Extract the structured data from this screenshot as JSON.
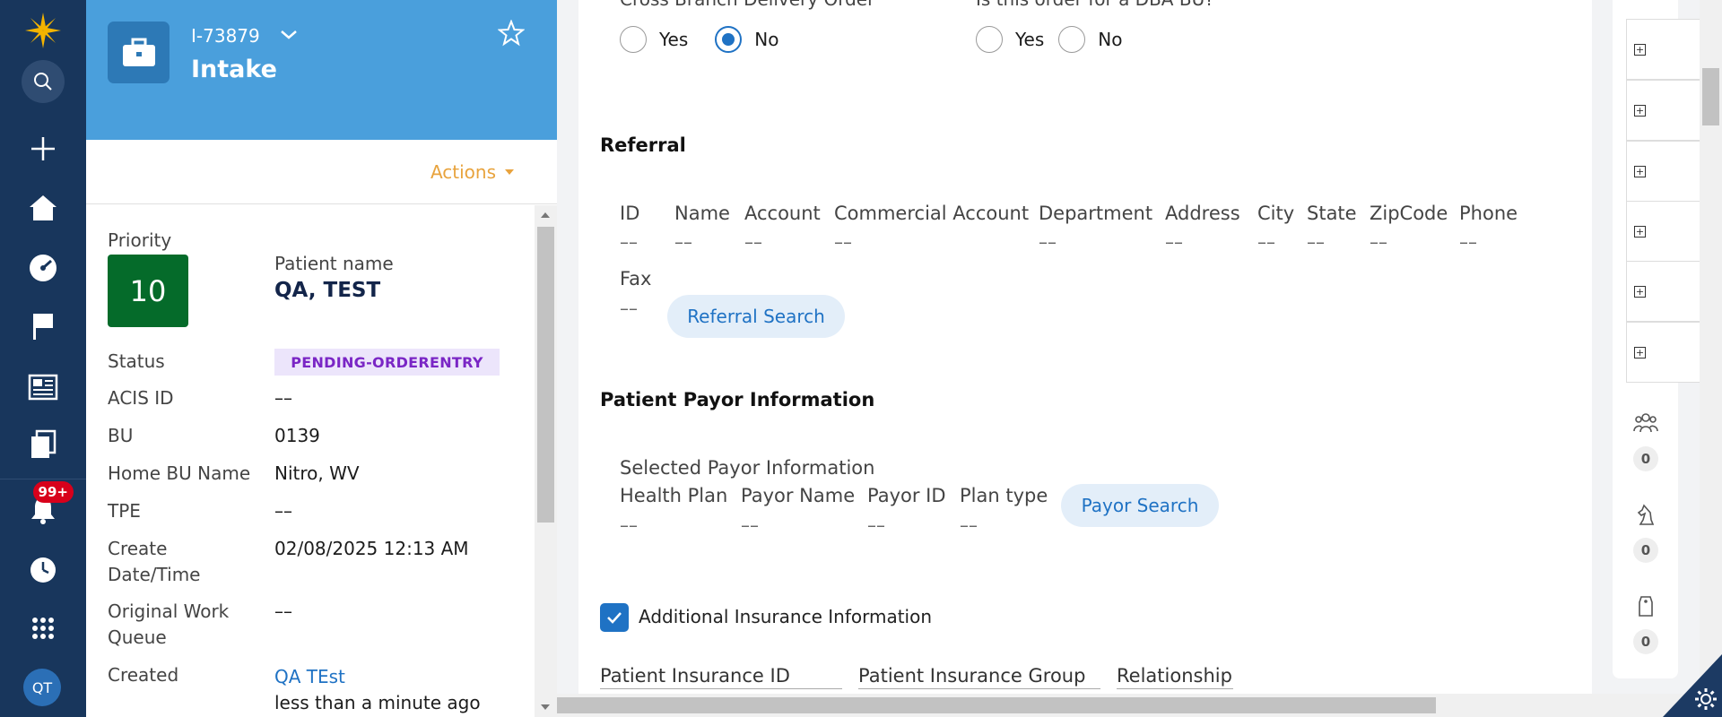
{
  "case": {
    "id": "I-73879",
    "title": "Intake",
    "actions_label": "Actions"
  },
  "details": {
    "priority_label": "Priority",
    "priority_value": "10",
    "patient_name_label": "Patient name",
    "patient_name": "QA, TEST",
    "status_label": "Status",
    "status_value": "PENDING-ORDERENTRY",
    "acis_label": "ACIS ID",
    "acis_value": "––",
    "bu_label": "BU",
    "bu_value": "0139",
    "home_bu_label": "Home BU Name",
    "home_bu_value": "Nitro, WV",
    "tpe_label": "TPE",
    "tpe_value": "––",
    "create_date_label_1": "Create",
    "create_date_label_2": "Date/Time",
    "create_date_value": "02/08/2025 12:13 AM",
    "owq_label_1": "Original Work",
    "owq_label_2": "Queue",
    "owq_value": "––",
    "created_label": "Created",
    "created_by": "QA TEst",
    "created_when": "less than a minute ago"
  },
  "form": {
    "cross_branch": {
      "label": "Cross Branch Delivery Order",
      "yes": "Yes",
      "no": "No",
      "selected": "No"
    },
    "dba_bu": {
      "label": "Is this order for a DBA BU?",
      "yes": "Yes",
      "no": "No",
      "selected": ""
    },
    "referral": {
      "title": "Referral",
      "columns": [
        "ID",
        "Name",
        "Account",
        "Commercial Account",
        "Department",
        "Address",
        "City",
        "State",
        "ZipCode",
        "Phone"
      ],
      "values": [
        "––",
        "––",
        "––",
        "––",
        "––",
        "––",
        "––",
        "––",
        "––",
        "––"
      ],
      "fax_label": "Fax",
      "fax_value": "––",
      "search_button": "Referral Search"
    },
    "payor": {
      "title": "Patient Payor Information",
      "subtitle": "Selected Payor Information",
      "columns": [
        "Health Plan",
        "Payor Name",
        "Payor ID",
        "Plan type"
      ],
      "values": [
        "––",
        "––",
        "––",
        "––"
      ],
      "search_button": "Payor Search"
    },
    "additional_insurance": {
      "label": "Additional Insurance Information",
      "checked": true
    },
    "insurance_fields": [
      "Patient Insurance ID",
      "Patient Insurance Group",
      "Relationship"
    ]
  },
  "nav": {
    "notification_count": "99+",
    "avatar_initials": "QT"
  },
  "utility": {
    "stats": [
      "0",
      "0",
      "0"
    ]
  },
  "colors": {
    "nav_bg": "#18365c",
    "header_bg": "#4a9fdc",
    "priority_bg": "#056b2a",
    "accent": "#1f72c4",
    "actions": "#e8a33d"
  }
}
